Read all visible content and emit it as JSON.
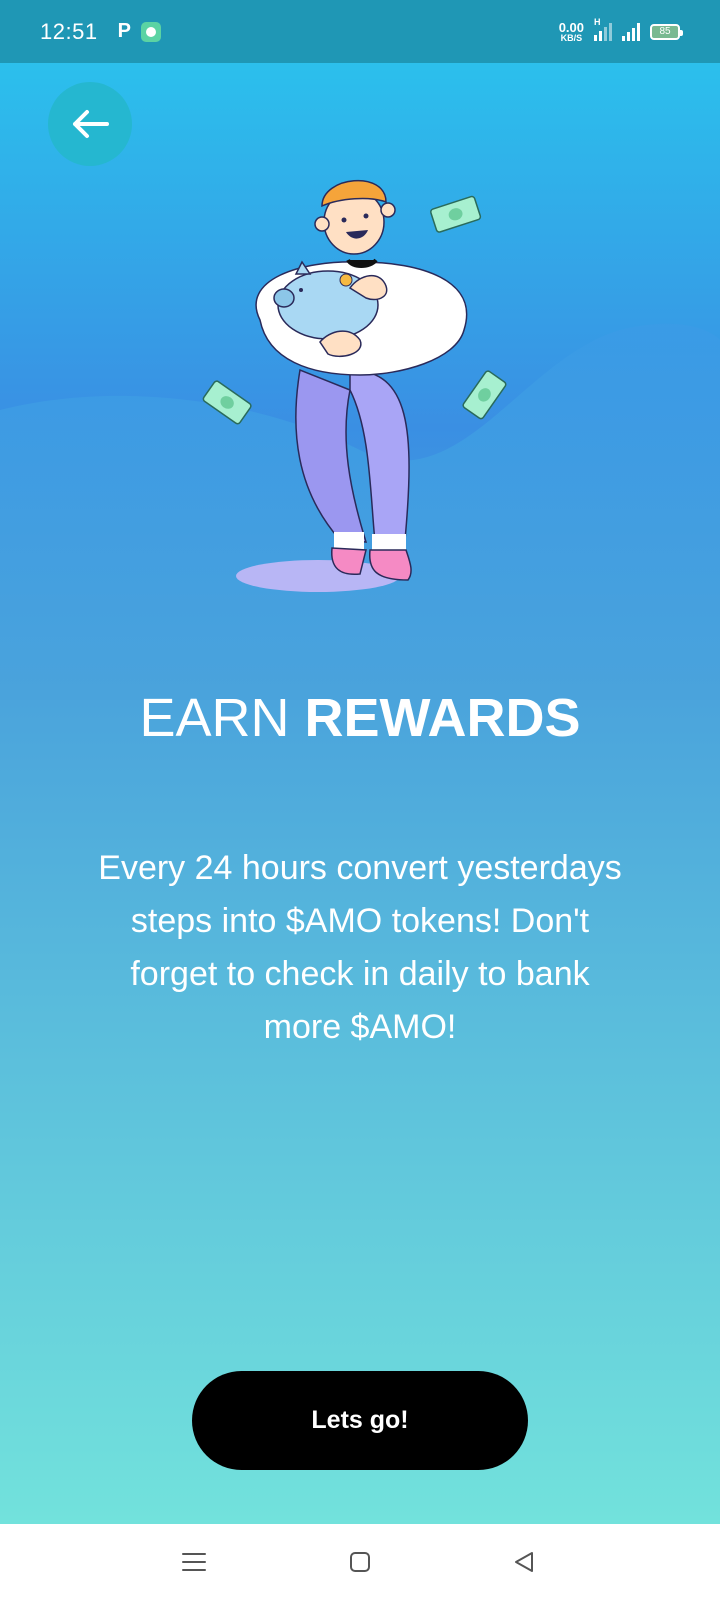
{
  "status_bar": {
    "time": "12:51",
    "notification_letter": "P",
    "net_speed_value": "0.00",
    "net_speed_unit": "KB/S",
    "network_type": "H",
    "battery_level": "85"
  },
  "header": {
    "back_icon": "arrow-left-icon"
  },
  "hero": {
    "title_light": "EARN",
    "title_bold": "REWARDS",
    "description": "Every 24 hours convert yesterdays steps into $AMO tokens! Don't forget to check in daily to bank more $AMO!"
  },
  "cta": {
    "label": "Lets go!"
  },
  "nav": {
    "menu_icon": "menu-icon",
    "home_icon": "home-square-icon",
    "back_icon": "back-triangle-icon"
  },
  "colors": {
    "status_bar": "#1f97b5",
    "back_button": "#25b7d0",
    "cta_bg": "#000000",
    "cta_text": "#ffffff",
    "gradient_top": "#29c8ee",
    "gradient_bottom": "#72e2dc"
  }
}
